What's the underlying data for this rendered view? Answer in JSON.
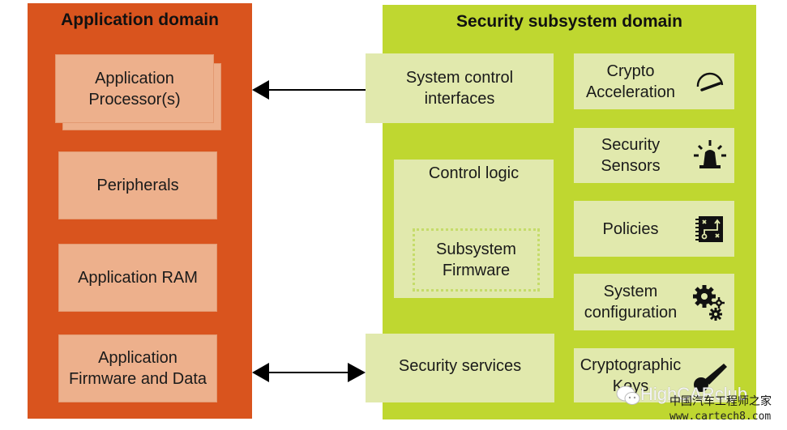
{
  "colors": {
    "application_domain": "#d9541e",
    "application_box": "#edb08c",
    "security_domain": "#bfd730",
    "security_box": "#e1e9ad",
    "arrow": "#000000"
  },
  "application_domain": {
    "title": "Application domain",
    "blocks": [
      {
        "label": "Application\nProcessor(s)",
        "stacked": true
      },
      {
        "label": "Peripherals"
      },
      {
        "label": "Application RAM"
      },
      {
        "label": "Application\nFirmware and Data"
      }
    ]
  },
  "security_domain": {
    "title": "Security subsystem domain",
    "left_blocks": [
      {
        "label": "System control\ninterfaces"
      },
      {
        "label": "Control logic",
        "inner": {
          "label": "Subsystem\nFirmware"
        }
      },
      {
        "label": "Security services"
      }
    ],
    "right_blocks": [
      {
        "label": "Crypto\nAcceleration",
        "icon": "speedometer-icon"
      },
      {
        "label": "Security\nSensors",
        "icon": "siren-icon"
      },
      {
        "label": "Policies",
        "icon": "strategy-board-icon"
      },
      {
        "label": "System\nconfiguration",
        "icon": "gears-icon"
      },
      {
        "label": "Cryptographic\nKeys",
        "icon": "key-icon"
      }
    ]
  },
  "connections": [
    {
      "from": "System control interfaces",
      "to": "Application Processor(s)",
      "direction": "one-way"
    },
    {
      "from": "Security services",
      "to": "Application Firmware and Data",
      "direction": "two-way"
    }
  ],
  "watermark": {
    "brand": "HighCARclub",
    "chinese": "中国汽车工程师之家",
    "url": "www.cartech8.com"
  }
}
